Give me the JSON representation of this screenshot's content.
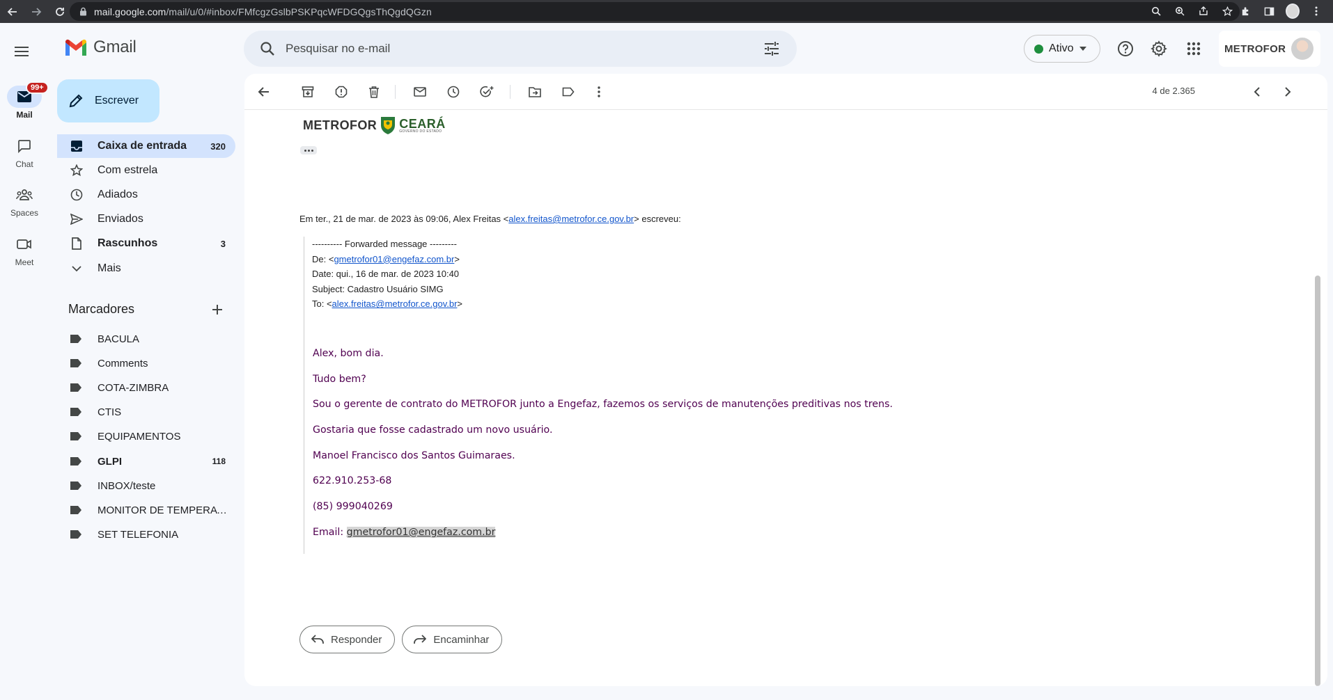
{
  "browser": {
    "url_host": "mail.google.com",
    "url_path": "/mail/u/0/#inbox/FMfcgzGslbPSKPqcWFDGQgsThQgdQGzn"
  },
  "rail": {
    "mail_label": "Mail",
    "mail_badge": "99+",
    "chat_label": "Chat",
    "spaces_label": "Spaces",
    "meet_label": "Meet"
  },
  "app": {
    "logo_text": "Gmail"
  },
  "search": {
    "placeholder": "Pesquisar no e-mail"
  },
  "header": {
    "status": "Ativo",
    "account_org": "METROFOR"
  },
  "compose": {
    "label": "Escrever"
  },
  "nav": [
    {
      "label": "Caixa de entrada",
      "count": "320"
    },
    {
      "label": "Com estrela",
      "count": ""
    },
    {
      "label": "Adiados",
      "count": ""
    },
    {
      "label": "Enviados",
      "count": ""
    },
    {
      "label": "Rascunhos",
      "count": "3"
    },
    {
      "label": "Mais",
      "count": ""
    }
  ],
  "labels_title": "Marcadores",
  "labels": [
    {
      "label": "BACULA",
      "count": ""
    },
    {
      "label": "Comments",
      "count": ""
    },
    {
      "label": "COTA-ZIMBRA",
      "count": ""
    },
    {
      "label": "CTIS",
      "count": ""
    },
    {
      "label": "EQUIPAMENTOS",
      "count": ""
    },
    {
      "label": "GLPI",
      "count": "118"
    },
    {
      "label": "INBOX/teste",
      "count": ""
    },
    {
      "label": "MONITOR DE TEMPERAT...",
      "count": ""
    },
    {
      "label": "SET TELEFONIA",
      "count": ""
    }
  ],
  "toolbar": {
    "pager": "4 de 2.365"
  },
  "message": {
    "logo_left": "METROFOR",
    "logo_right": "CEARÁ",
    "logo_sub": "GOVERNO DO ESTADO",
    "quote_prefix": "Em ter., 21 de mar. de 2023 às 09:06, Alex Freitas <",
    "quote_email": "alex.freitas@metrofor.ce.gov.br",
    "quote_suffix": "> escreveu:",
    "fw_header": "---------- Forwarded message ---------",
    "fw_from_prefix": "De: <",
    "fw_from_email": "gmetrofor01@engefaz.com.br",
    "fw_from_suffix": ">",
    "fw_date": "Date: qui., 16 de mar. de 2023 10:40",
    "fw_subject": "Subject: Cadastro Usuário SIMG",
    "fw_to_prefix": "To: <",
    "fw_to_email": "alex.freitas@metrofor.ce.gov.br",
    "fw_to_suffix": ">",
    "body": [
      "Alex, bom dia.",
      "Tudo bem?",
      "Sou o gerente de contrato do METROFOR junto a Engefaz, fazemos os serviços de manutenções preditivas nos trens.",
      "Gostaria que fosse cadastrado um novo usuário.",
      "Manoel Francisco dos Santos Guimaraes.",
      "622.910.253-68",
      "(85) 999040269"
    ],
    "email_prefix": "Email: ",
    "email_value": "gmetrofor01@engefaz.com.br"
  },
  "actions": {
    "reply": "Responder",
    "forward": "Encaminhar"
  }
}
